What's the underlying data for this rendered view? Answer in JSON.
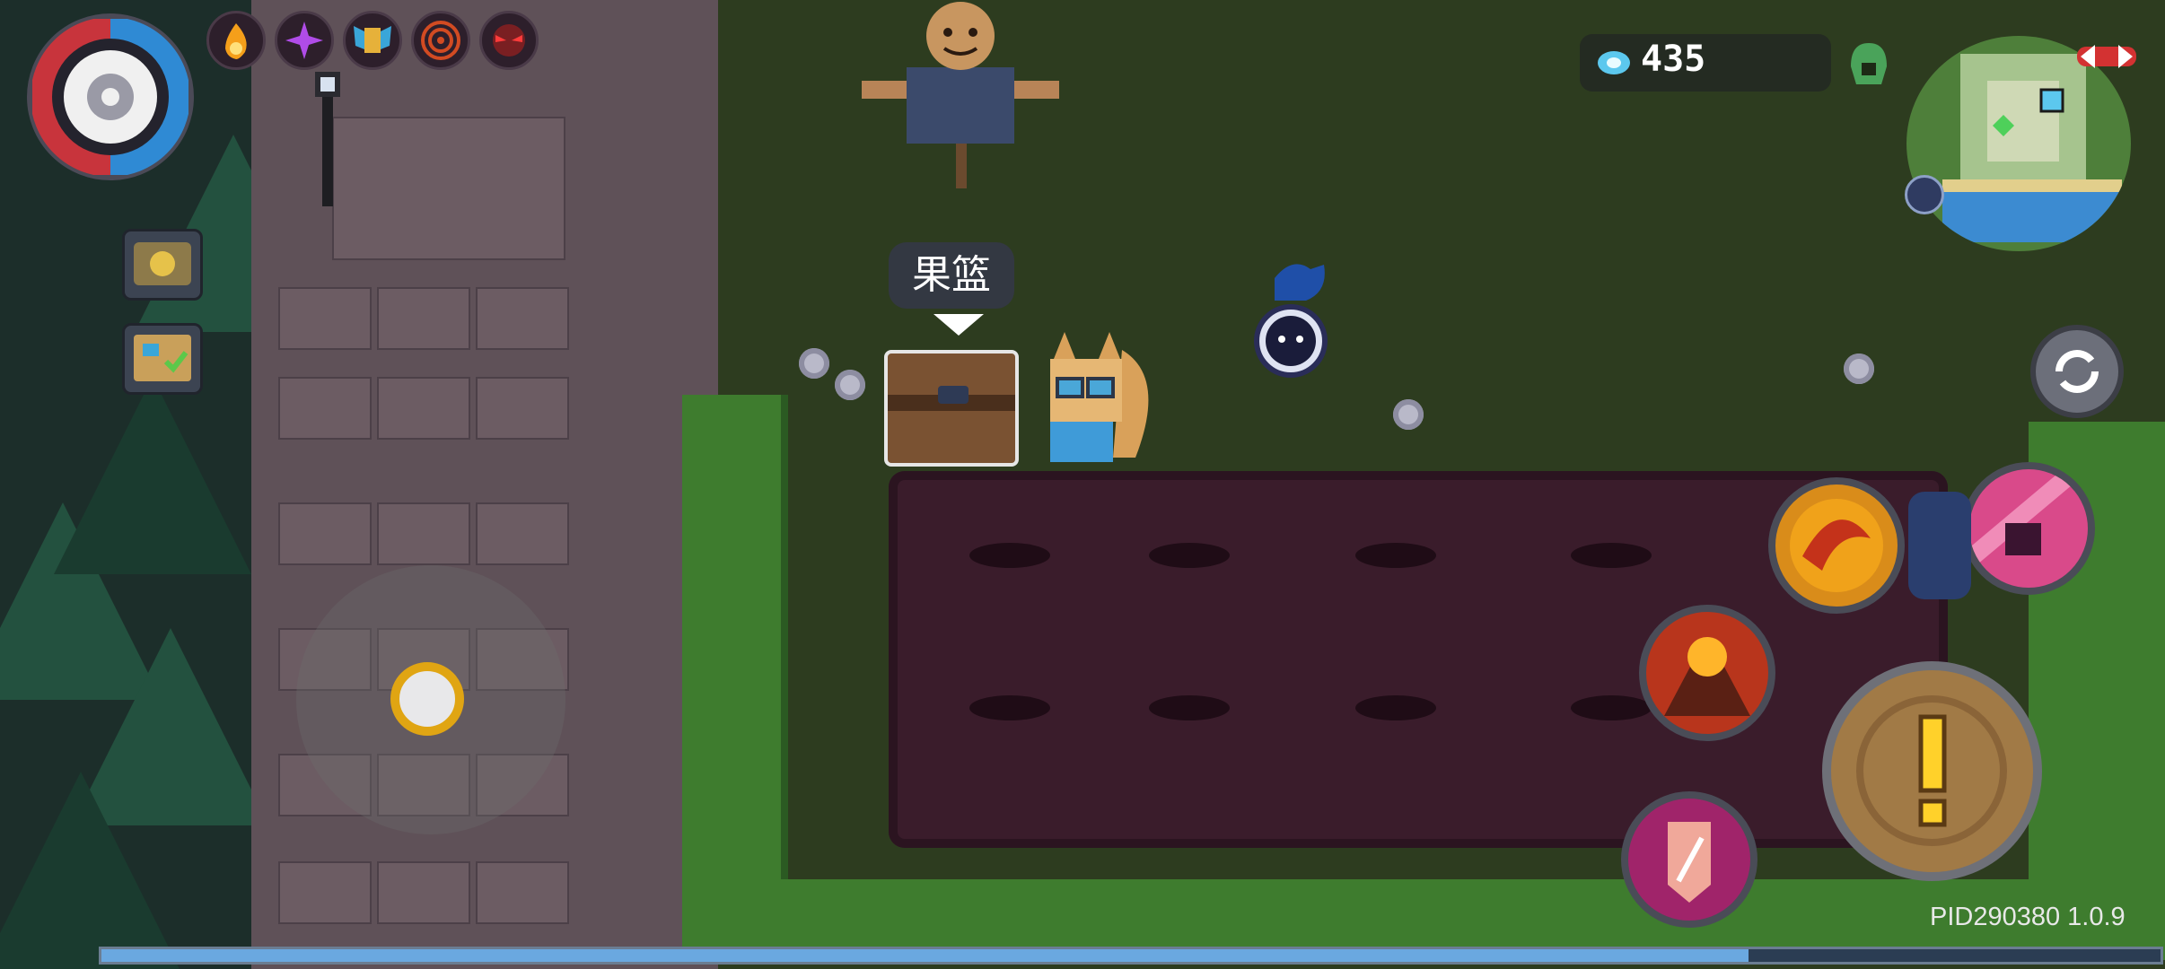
{
  "world": {
    "chest_label": "果篮"
  },
  "hud": {
    "gem_count": "435",
    "version": "PID290380 1.0.9",
    "experience_progress": 0.8
  },
  "colors": {
    "health_red": "#c8343c",
    "mana_blue": "#2f8ad4",
    "gem_blue": "#5cc8ee",
    "action_brown": "#a17a46",
    "joystick_gold": "#e0a513"
  },
  "status_icons": [
    "flame-icon",
    "void-spark-icon",
    "winged-armor-icon",
    "target-rings-icon",
    "red-eyes-icon"
  ],
  "skills": [
    "phoenix-strike-icon",
    "paw-meteor-icon",
    "volcano-eruption-icon",
    "shield-banner-icon"
  ]
}
